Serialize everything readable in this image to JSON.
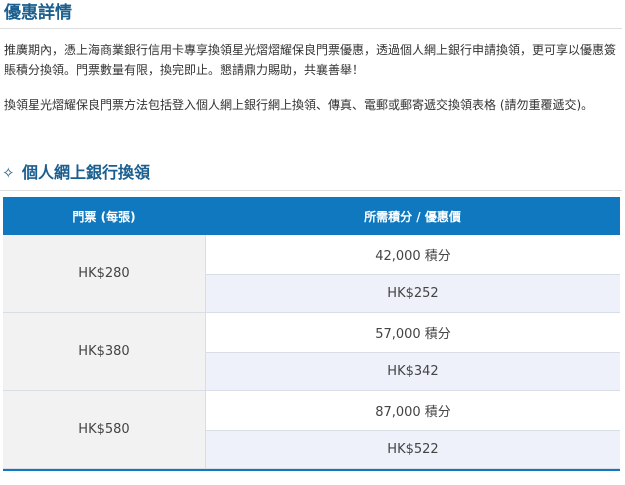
{
  "section": {
    "title": "優惠詳情",
    "paragraph1": "推廣期內，憑上海商業銀行信用卡專享換領星光熠熠耀保良門票優惠，透過個人網上銀行申請換領，更可享以優惠簽賬積分換領。門票數量有限，換完即止。懇請鼎力賜助，共襄善舉！",
    "paragraph2": "換領星光熠耀保良門票方法包括登入個人網上銀行網上換領、傳真、電郵或郵寄遞交換領表格 (請勿重覆遞交)。"
  },
  "online": {
    "heading": "個人網上銀行換領",
    "icon": "diamond-outline-icon"
  },
  "table": {
    "header": {
      "ticket": "門票 (每張)",
      "required": "所需積分 / 優惠價"
    },
    "rows": [
      {
        "ticket": "HK$280",
        "points": "42,000 積分",
        "price": "HK$252"
      },
      {
        "ticket": "HK$380",
        "points": "57,000 積分",
        "price": "HK$342"
      },
      {
        "ticket": "HK$580",
        "points": "87,000 積分",
        "price": "HK$522"
      }
    ]
  },
  "colors": {
    "accent": "#1a5f8f",
    "header_bg": "#0f78be",
    "row_alt": "#eef1fa",
    "price_bg": "#f2f2f2"
  }
}
